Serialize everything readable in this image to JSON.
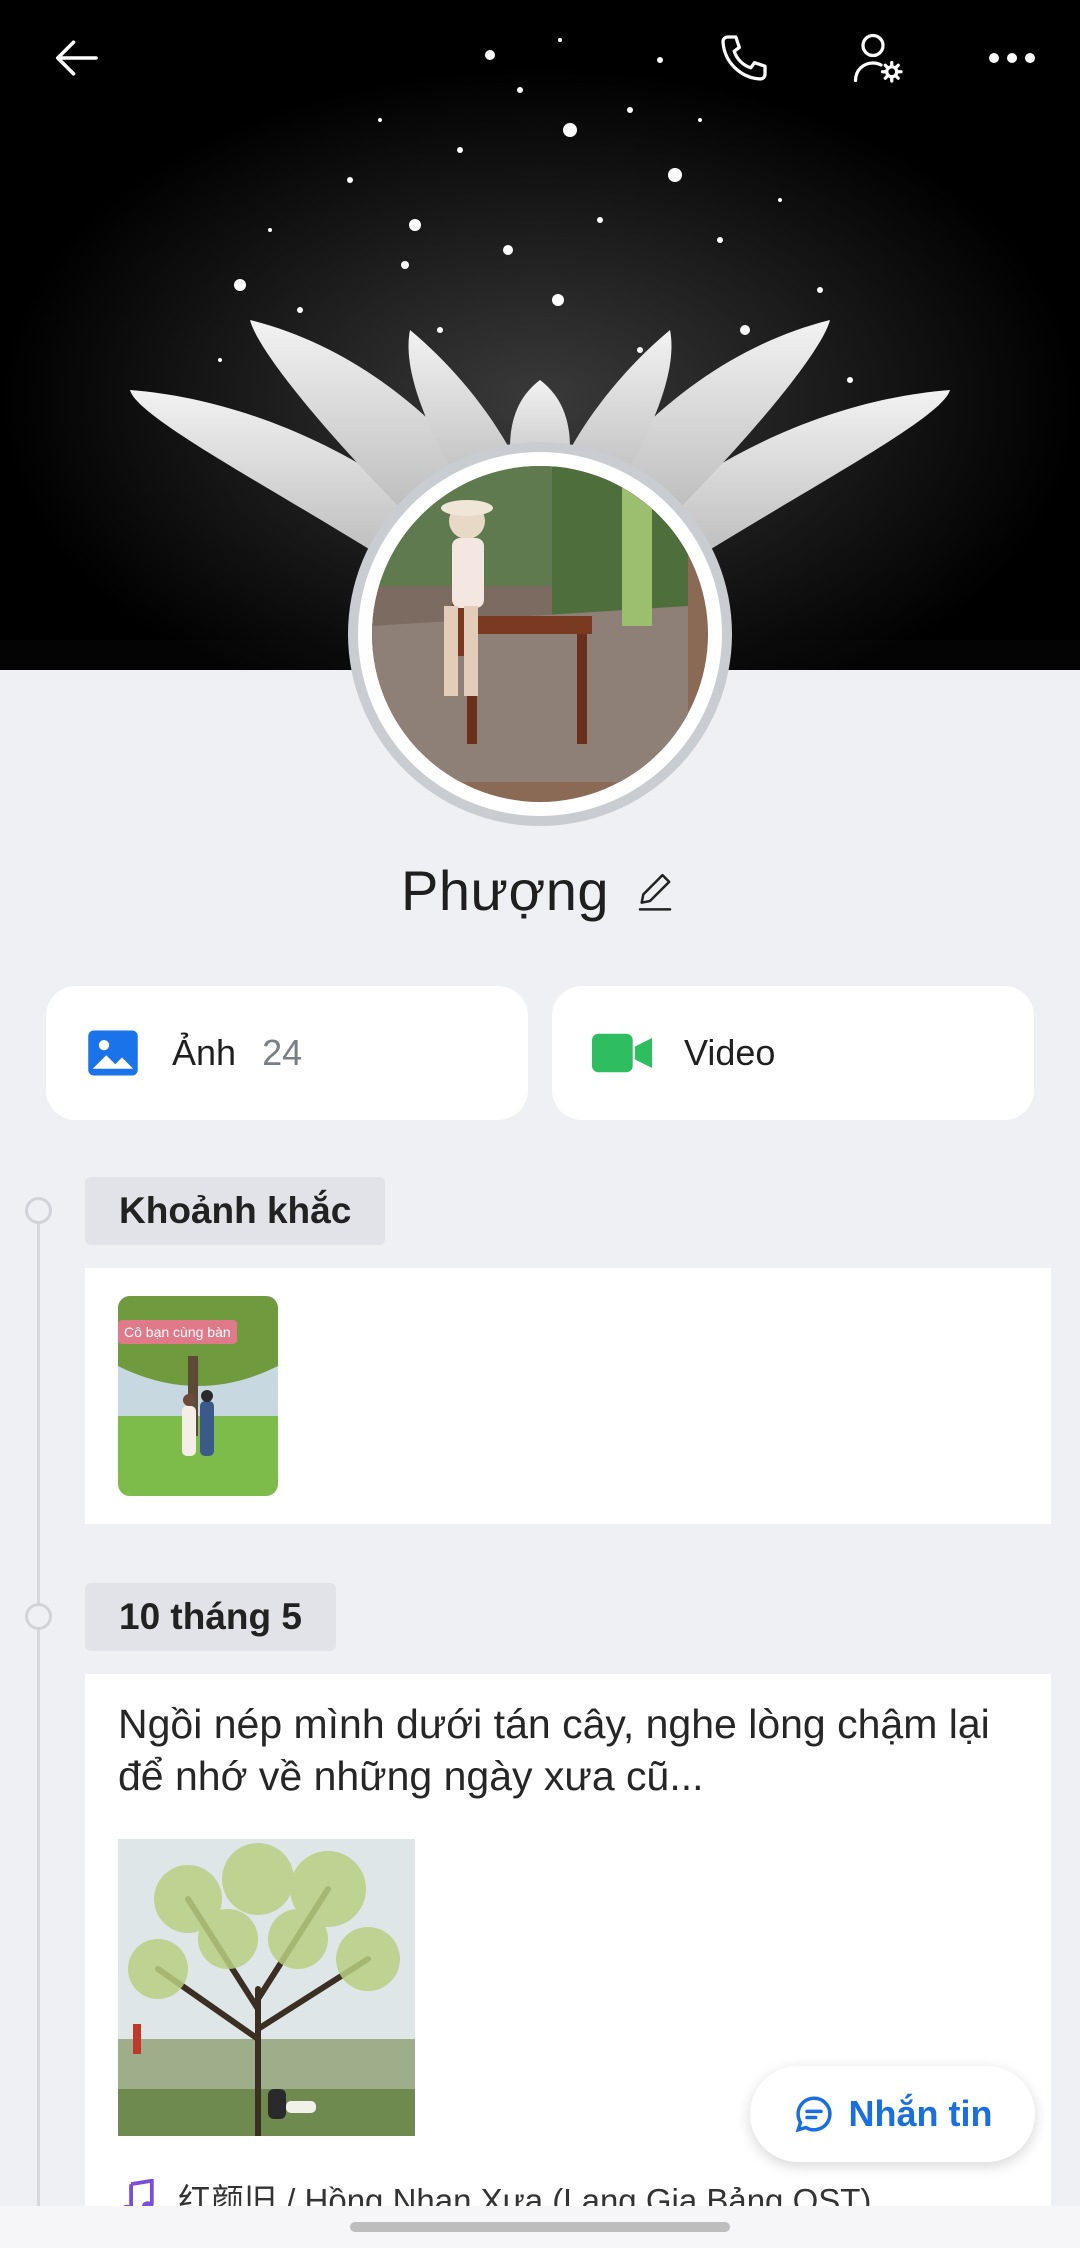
{
  "profile": {
    "name": "Phượng"
  },
  "topbar": {
    "back_icon": "arrow-left-icon",
    "call_icon": "phone-icon",
    "settings_icon": "user-gear-icon",
    "more_icon": "more-horizontal-icon"
  },
  "media": {
    "photos_label": "Ảnh",
    "photos_count": "24",
    "videos_label": "Video"
  },
  "moments": {
    "title": "Khoảnh khắc",
    "sticker_text": "Cô bạn cùng bàn"
  },
  "post": {
    "date": "10 tháng 5",
    "text": "Ngồi nép mình dưới tán cây, nghe lòng chậm lại để nhớ về những ngày xưa cũ...",
    "music": "红颜旧 / Hồng Nhan Xưa (Lang Gia Bảng OST)"
  },
  "fab": {
    "label": "Nhắn tin"
  },
  "colors": {
    "accent": "#1a6fe0",
    "photo_icon": "#1a73e8",
    "video_icon": "#2fbe5f",
    "background": "#eff0f4"
  }
}
